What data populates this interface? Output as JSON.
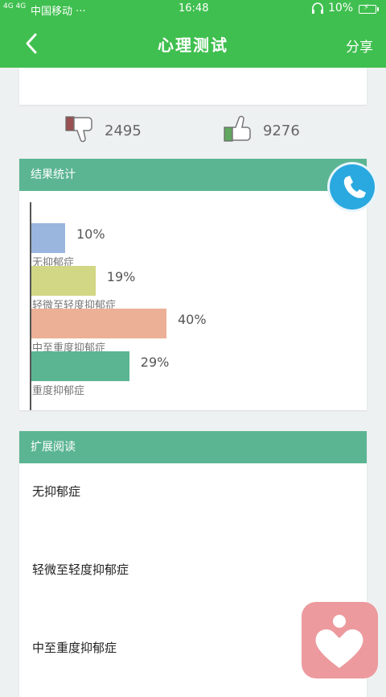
{
  "status_bar": {
    "signal": "4G 4G",
    "carrier": "中国移动 ···",
    "time": "16:48",
    "battery": "10%"
  },
  "nav": {
    "title": "心理测试",
    "share": "分享"
  },
  "votes": {
    "dislike_count": "2495",
    "like_count": "9276"
  },
  "results": {
    "header": "结果统计",
    "bars": [
      {
        "label": "无抑郁症",
        "percent": 10,
        "percent_text": "10%",
        "color": "#9bb6de"
      },
      {
        "label": "轻微至轻度抑郁症",
        "percent": 19,
        "percent_text": "19%",
        "color": "#d1d784"
      },
      {
        "label": "中至重度抑郁症",
        "percent": 40,
        "percent_text": "40%",
        "color": "#ebb096"
      },
      {
        "label": "重度抑郁症",
        "percent": 29,
        "percent_text": "29%",
        "color": "#5bb592"
      }
    ]
  },
  "reading": {
    "header": "扩展阅读",
    "items": [
      "无抑郁症",
      "轻微至轻度抑郁症",
      "中至重度抑郁症"
    ]
  },
  "colors": {
    "primary_green": "#3fbf4f",
    "section_green": "#5bb592",
    "call_blue": "#2aa8e0",
    "heart_pink": "#ec9a9e"
  },
  "icons": {
    "back": "back-arrow-icon",
    "dislike": "thumbs-down-icon",
    "like": "thumbs-up-icon",
    "call": "phone-icon",
    "heart": "heart-icon"
  }
}
